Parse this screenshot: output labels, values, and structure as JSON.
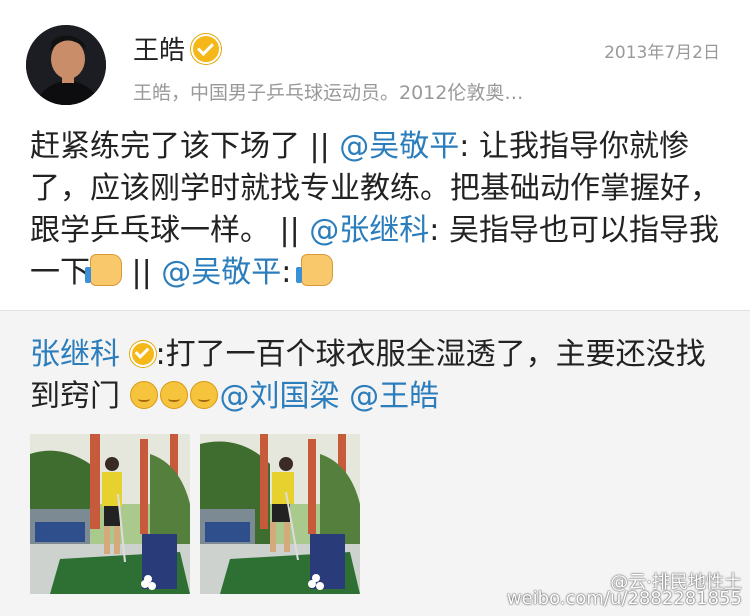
{
  "post": {
    "author": "王皓",
    "date": "2013年7月2日",
    "bio": "王皓，中国男子乒乓球运动员。2012伦敦奥…",
    "text_parts": [
      "赶紧练完了该下场了 || ",
      "@吴敬平",
      ": 让我指导你就惨了，应该刚学时就找专业教练。把基础动作掌握好，跟学乒乓球一样。 || ",
      "@张继科",
      ": 吴指导也可以指导我一下",
      " || ",
      "@吴敬平",
      ": "
    ]
  },
  "retweet": {
    "author": "张继科",
    "text": ":打了一百个球衣服全湿透了，主要还没找到窍门",
    "mention_1": "@刘国梁",
    "mention_2": "@王皓"
  },
  "watermark": {
    "line1": "@云·排民地性土",
    "line2": "weibo.com/u/2882281855"
  },
  "colors": {
    "link": "#2b7dbc",
    "verified": "#f5b818",
    "retweet_bg": "#f4f4f4"
  }
}
